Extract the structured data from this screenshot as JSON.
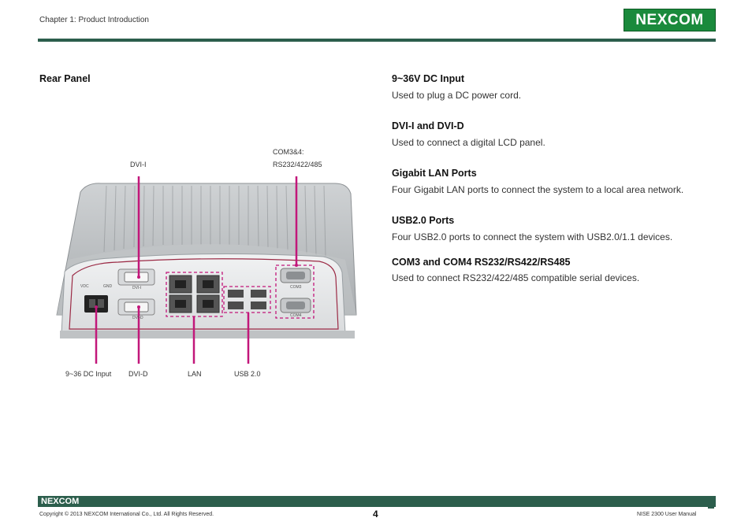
{
  "header": {
    "chapter": "Chapter 1: Product Introduction",
    "logo": "NEXCOM"
  },
  "section": {
    "title": "Rear Panel"
  },
  "items": [
    {
      "title": "9~36V DC Input",
      "desc": "Used to plug a DC power cord."
    },
    {
      "title": "DVI-I and DVI-D",
      "desc": "Used to connect a digital LCD panel."
    },
    {
      "title": "Gigabit LAN Ports",
      "desc": "Four Gigabit LAN ports to connect the system to a local area network."
    },
    {
      "title": "USB2.0 Ports",
      "desc": "Four USB2.0 ports to connect the system with USB2.0/1.1 devices."
    },
    {
      "title": "COM3 and COM4 RS232/RS422/RS485",
      "desc": "Used to connect RS232/422/485 compatible serial devices."
    }
  ],
  "callouts": {
    "dvi_i": "DVI-I",
    "com_line1": "COM3&4:",
    "com_line2": "RS232/422/485",
    "dc_input": "9~36 DC Input",
    "dvi_d": "DVI-D",
    "lan": "LAN",
    "usb": "USB 2.0"
  },
  "device_labels": {
    "vdc": "VDC",
    "gnd": "GND",
    "dvi_i": "DVI-I",
    "dvi_d": "DVI-D",
    "com3": "COM3",
    "com4": "COM4"
  },
  "footer": {
    "logo": "NEXCOM",
    "copyright": "Copyright © 2013 NEXCOM International Co., Ltd. All Rights Reserved.",
    "page": "4",
    "manual": "NISE 2300 User Manual"
  },
  "colors": {
    "brand_green": "#1a8a3c",
    "rule": "#2c5e4c",
    "callout": "#c2177a"
  }
}
